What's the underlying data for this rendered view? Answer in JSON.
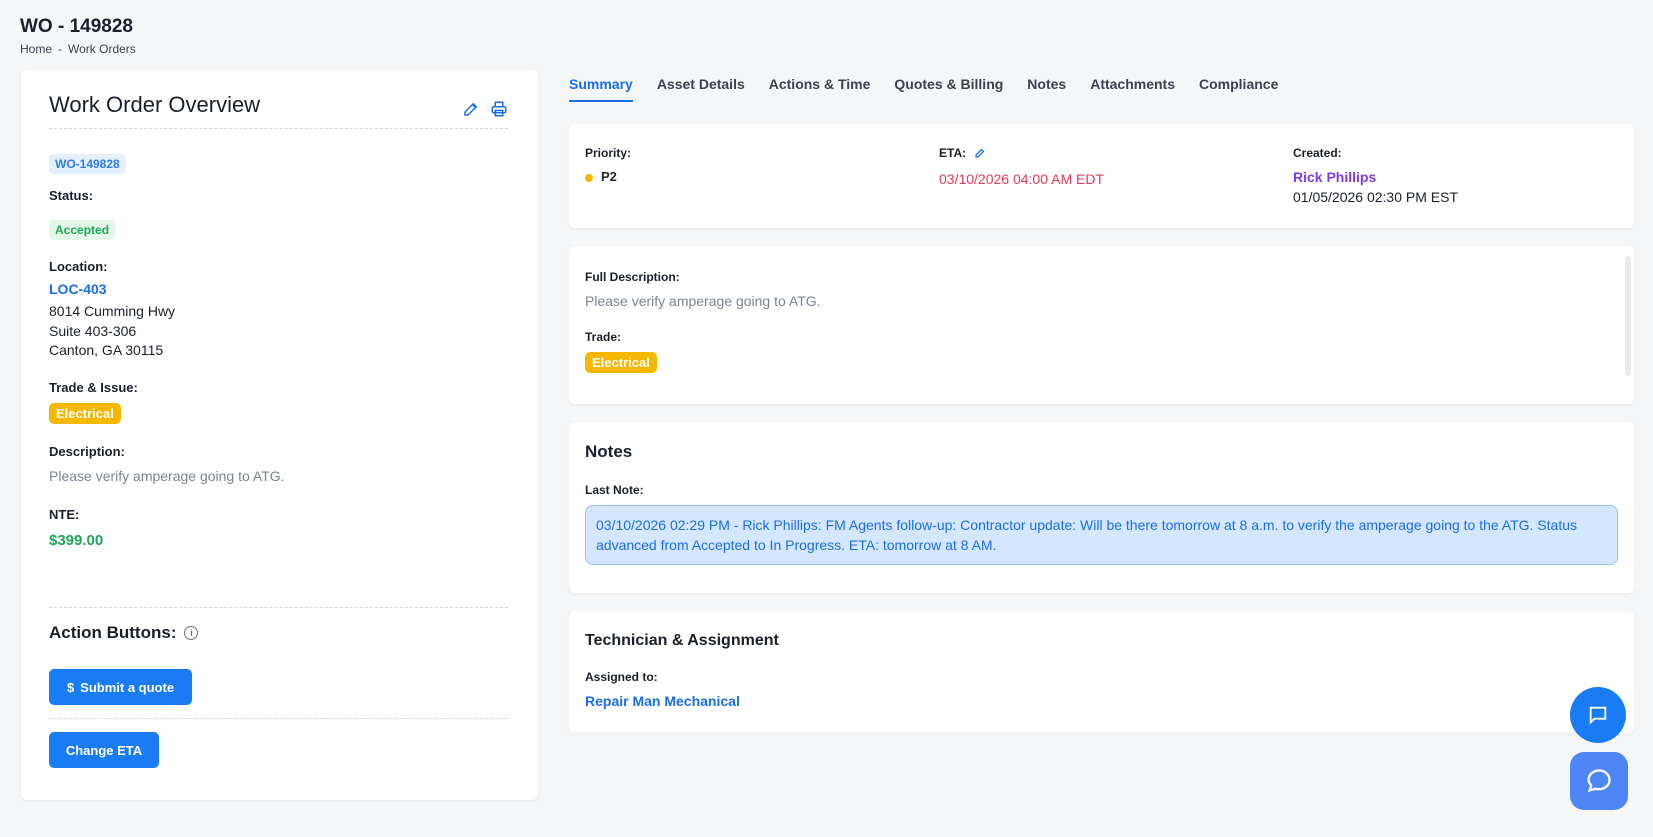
{
  "header": {
    "title": "WO - 149828",
    "breadcrumb": [
      "Home",
      "Work Orders"
    ],
    "breadcrumb_sep": "-"
  },
  "overview": {
    "title": "Work Order Overview",
    "wo_id": "WO-149828",
    "status_label": "Status:",
    "status": "Accepted",
    "location_label": "Location:",
    "location_code": "LOC-403",
    "address_lines": [
      "8014 Cumming Hwy",
      "Suite 403-306",
      "Canton, GA 30115"
    ],
    "trade_label": "Trade & Issue:",
    "trade": "Electrical",
    "description_label": "Description:",
    "description": "Please verify amperage going to ATG.",
    "nte_label": "NTE:",
    "nte": "$399.00",
    "action_title": "Action Buttons:",
    "submit_quote_label": "Submit a quote",
    "submit_quote_icon": "$",
    "change_eta_label": "Change ETA"
  },
  "tabs": [
    {
      "label": "Summary",
      "active": true
    },
    {
      "label": "Asset Details"
    },
    {
      "label": "Actions & Time"
    },
    {
      "label": "Quotes & Billing"
    },
    {
      "label": "Notes"
    },
    {
      "label": "Attachments"
    },
    {
      "label": "Compliance"
    }
  ],
  "summary": {
    "priority_label": "Priority:",
    "priority": "P2",
    "eta_label": "ETA:",
    "eta": "03/10/2026 04:00 AM EDT",
    "created_label": "Created:",
    "created_by": "Rick Phillips",
    "created_at": "01/05/2026 02:30 PM EST"
  },
  "full_description": {
    "label": "Full Description:",
    "text": "Please verify amperage going to ATG.",
    "trade_label": "Trade:",
    "trade": "Electrical"
  },
  "notes": {
    "title": "Notes",
    "last_note_label": "Last Note:",
    "last_note": "03/10/2026 02:29 PM - Rick Phillips: FM Agents follow-up: Contractor update: Will be there tomorrow at 8 a.m. to verify the amperage going to the ATG. Status advanced from Accepted to In Progress. ETA: tomorrow at 8 AM."
  },
  "technician": {
    "title": "Technician & Assignment",
    "assigned_label": "Assigned to:",
    "assigned_to": "Repair Man Mechanical"
  },
  "colors": {
    "accent": "#1a7cf5",
    "status_green": "#1fa557",
    "trade_yellow": "#f5b700",
    "eta_red": "#e23b5b",
    "creator_purple": "#7c3aed"
  },
  "icons": [
    "pencil-icon",
    "printer-icon",
    "info-icon",
    "chat-icon",
    "support-icon"
  ]
}
